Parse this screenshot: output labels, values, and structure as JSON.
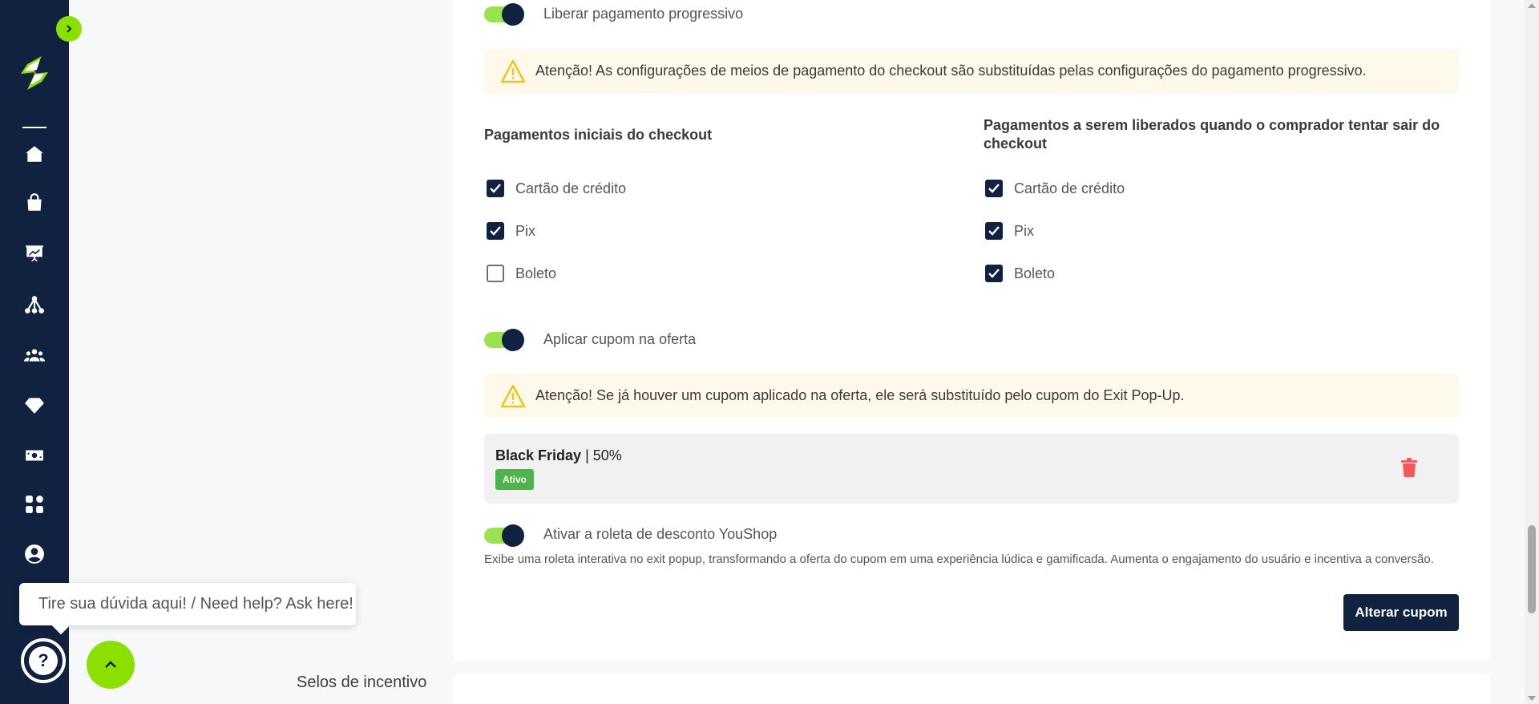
{
  "sidebar": {
    "icons": [
      "home-icon",
      "shopping-bag-icon",
      "presentation-chart-icon",
      "network-icon",
      "users-icon",
      "diamond-icon",
      "money-icon",
      "apps-grid-icon",
      "user-circle-icon"
    ]
  },
  "progressive": {
    "toggle_label": "Liberar pagamento progressivo",
    "alert": "Atenção! As configurações de meios de pagamento do checkout são substituídas pelas configurações do pagamento progressivo.",
    "initial_title": "Pagamentos iniciais do checkout",
    "released_title": "Pagamentos a serem liberados quando o comprador tentar sair do checkout",
    "initial_methods": [
      {
        "label": "Cartão de crédito",
        "checked": true
      },
      {
        "label": "Pix",
        "checked": true
      },
      {
        "label": "Boleto",
        "checked": false
      }
    ],
    "released_methods": [
      {
        "label": "Cartão de crédito",
        "checked": true
      },
      {
        "label": "Pix",
        "checked": true
      },
      {
        "label": "Boleto",
        "checked": true
      }
    ]
  },
  "coupon": {
    "toggle_label": "Aplicar cupom na oferta",
    "alert": "Atenção! Se já houver um cupom aplicado na oferta, ele será substituído pelo cupom do Exit Pop-Up.",
    "name": "Black Friday",
    "separator": " | ",
    "discount": "50%",
    "status": "Ativo"
  },
  "roulette": {
    "toggle_label": "Ativar a roleta de desconto YouShop",
    "description": "Exibe uma roleta interativa no exit popup, transformando a oferta do cupom em uma experiência lúdica e gamificada. Aumenta o engajamento do usuário e incentiva a conversão."
  },
  "actions": {
    "change_coupon": "Alterar cupom"
  },
  "left_section": {
    "selos_label": "Selos de incentivo"
  },
  "help": {
    "tooltip": "Tire sua dúvida aqui! / Need help? Ask here!",
    "icon_glyph": "?"
  },
  "colors": {
    "navy": "#112240",
    "lime": "#8be000",
    "toggle_track": "#9be24f",
    "alert_bg": "#fef9ea",
    "badge_green": "#4cb44a",
    "trash_red": "#f25a5a"
  }
}
